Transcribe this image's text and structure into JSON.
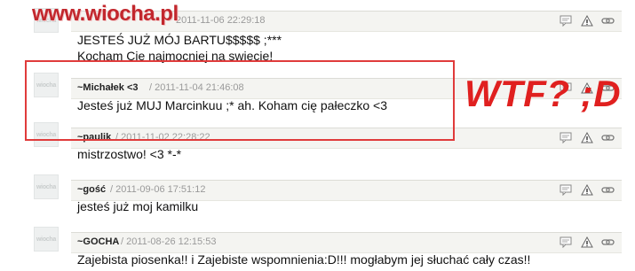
{
  "watermark": {
    "logo": "www.wiocha.pl"
  },
  "overlay": {
    "annotation": "WTF? ;D",
    "annotation_color": "#e0201f",
    "box_color": "#e03b3b"
  },
  "comments": [
    {
      "author": "",
      "date": "2011-11-06 22:29:18",
      "lines": [
        "JESTEŚ JUŻ MÓJ BARTU$$$$$ ;***",
        "Kocham Cie najmocniej na swiecie!"
      ]
    },
    {
      "author": "~Michałek <3",
      "date": "/ 2011-11-04 21:46:08",
      "lines": [
        "Jesteś już MUJ Marcinkuu ;* ah. Koham cię pałeczko <3"
      ]
    },
    {
      "author": "~paulik",
      "date": "/ 2011-11-02 22:28:22",
      "lines": [
        "mistrzostwo! <3 *-*"
      ]
    },
    {
      "author": "~gość",
      "date": "/ 2011-09-06 17:51:12",
      "lines": [
        "jesteś już moj kamilku"
      ]
    },
    {
      "author": "~GOCHA",
      "date": "/ 2011-08-26 12:15:53",
      "lines": [
        "Zajebista piosenka!! i Zajebiste wspomnienia:D!!! mogłabym jej słuchać cały czas!!"
      ]
    }
  ],
  "icons": {
    "comment": "speech-bubble-icon",
    "report": "warning-triangle-icon",
    "link": "chain-link-icon"
  },
  "avatar_placeholder": "wiocha"
}
